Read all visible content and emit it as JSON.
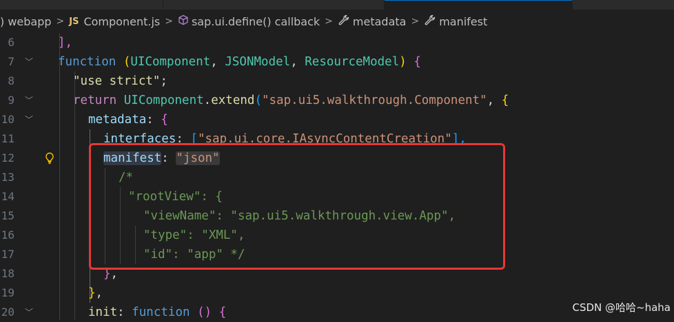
{
  "breadcrumbs": [
    {
      "label": ") webapp"
    },
    {
      "badge": "JS",
      "label": "Component.js"
    },
    {
      "label": "sap.ui.define() callback",
      "icon": "cube-icon"
    },
    {
      "label": "metadata",
      "icon": "wrench-icon"
    },
    {
      "label": "manifest",
      "icon": "wrench-icon"
    }
  ],
  "editor": {
    "lines": [
      {
        "n": "6"
      },
      {
        "n": "7"
      },
      {
        "n": "8"
      },
      {
        "n": "9"
      },
      {
        "n": "10"
      },
      {
        "n": "11"
      },
      {
        "n": "12"
      },
      {
        "n": "13"
      },
      {
        "n": "14"
      },
      {
        "n": "15"
      },
      {
        "n": "16"
      },
      {
        "n": "17"
      },
      {
        "n": "18"
      },
      {
        "n": "19"
      },
      {
        "n": "20"
      }
    ],
    "tokens": {
      "l6": {
        "a": "],"
      },
      "l7": {
        "a": "function",
        "b": " (",
        "c": "UIComponent",
        "d": ", ",
        "e": "JSONModel",
        "f": ", ",
        "g": "ResourceModel",
        "h": ") ",
        "i": "{"
      },
      "l8": {
        "a": "\"use strict\"",
        "b": ";"
      },
      "l9": {
        "a": "return",
        "b": " ",
        "c": "UIComponent",
        "d": ".",
        "e": "extend",
        "f": "(",
        "g": "\"sap.ui5.walkthrough.Component\"",
        "h": ", ",
        "i": "{"
      },
      "l10": {
        "a": "metadata",
        "b": ": ",
        "c": "{"
      },
      "l11": {
        "a": "interfaces",
        "b": ": ",
        "c": "[",
        "d": "\"sap.ui.core.IAsyncContentCreation\"",
        "e": "],"
      },
      "l12": {
        "a": "manifest",
        "b": ": ",
        "c": "\"json\""
      },
      "l13": {
        "a": "/*"
      },
      "l14": {
        "a": "\"rootView\": {"
      },
      "l15": {
        "a": "\"viewName\": \"sap.ui5.walkthrough.view.App\","
      },
      "l16": {
        "a": "\"type\": \"XML\","
      },
      "l17": {
        "a": "\"id\": \"app\" */"
      },
      "l18": {
        "a": "}",
        "b": ","
      },
      "l19": {
        "a": "}",
        "b": ","
      },
      "l20": {
        "a": "init",
        "b": ": ",
        "c": "function",
        "d": " () ",
        "e": "{"
      }
    }
  },
  "watermark": "CSDN @哈哈~haha"
}
